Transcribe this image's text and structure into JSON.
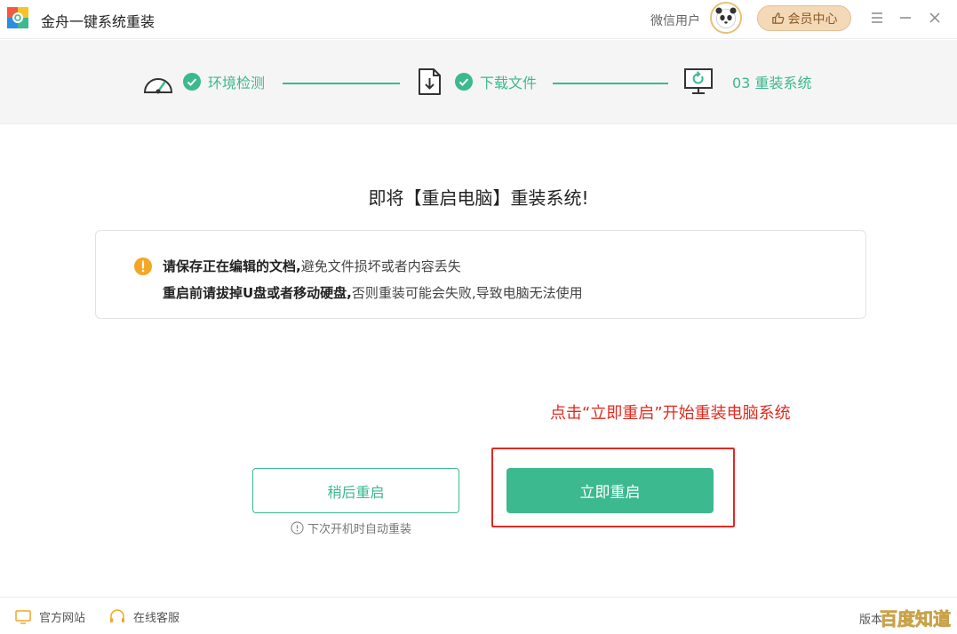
{
  "titlebar": {
    "title": "金舟一键系统重装",
    "user_name": "微信用户",
    "vip_label": "会员中心"
  },
  "steps": [
    {
      "label": "环境检测",
      "status": "done",
      "icon": "speedometer-icon"
    },
    {
      "label": "下载文件",
      "status": "done",
      "icon": "download-file-icon"
    },
    {
      "label": "03 重装系统",
      "status": "active",
      "icon": "monitor-restart-icon"
    }
  ],
  "main": {
    "heading": "即将【重启电脑】重装系统!",
    "notice": {
      "line1_bold": "请保存正在编辑的文档,",
      "line1_rest": "避免文件损坏或者内容丢失",
      "line2_bold": "重启前请拔掉U盘或者移动硬盘,",
      "line2_rest": "否则重装可能会失败,导致电脑无法使用"
    },
    "annotation": "点击“立即重启”开始重装电脑系统",
    "later_button": "稍后重启",
    "later_hint": "下次开机时自动重装",
    "now_button": "立即重启"
  },
  "footer": {
    "site_link": "官方网站",
    "service_link": "在线客服",
    "version_prefix": "版本"
  },
  "watermark": "百度知道",
  "colors": {
    "accent": "#3cb98f",
    "warning": "#f5a623",
    "annotation": "#e02b20",
    "vip_bg": "#f4d9b8"
  }
}
